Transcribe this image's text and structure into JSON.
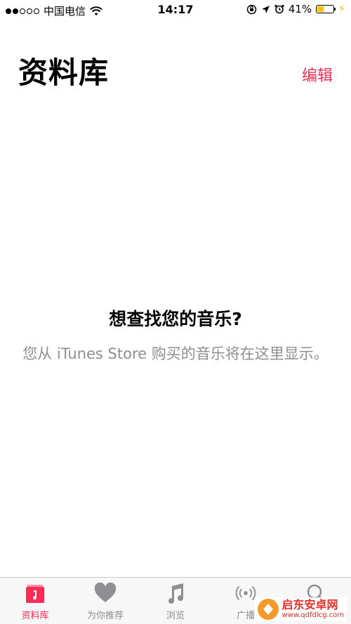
{
  "status_bar": {
    "carrier": "中国电信",
    "time": "14:17",
    "battery": "41%",
    "battery_level": 0.41
  },
  "header": {
    "title": "资料库",
    "edit_label": "编辑"
  },
  "empty_state": {
    "title": "想查找您的音乐?",
    "description": "您从 iTunes Store 购买的音乐将在这里显示。"
  },
  "tabs": [
    {
      "label": "资料库",
      "icon": "music-note-library-icon",
      "active": true
    },
    {
      "label": "为你推荐",
      "icon": "heart-icon",
      "active": false
    },
    {
      "label": "浏览",
      "icon": "music-note-icon",
      "active": false
    },
    {
      "label": "广播",
      "icon": "radio-broadcast-icon",
      "active": false
    },
    {
      "label": "搜索",
      "icon": "search-icon",
      "active": false
    }
  ],
  "watermark": {
    "main": "启东安卓网",
    "sub": "www.qdfdlcg.com"
  },
  "colors": {
    "accent": "#ff2d55",
    "secondary_text": "#8e8e93",
    "battery": "#f5c200"
  }
}
